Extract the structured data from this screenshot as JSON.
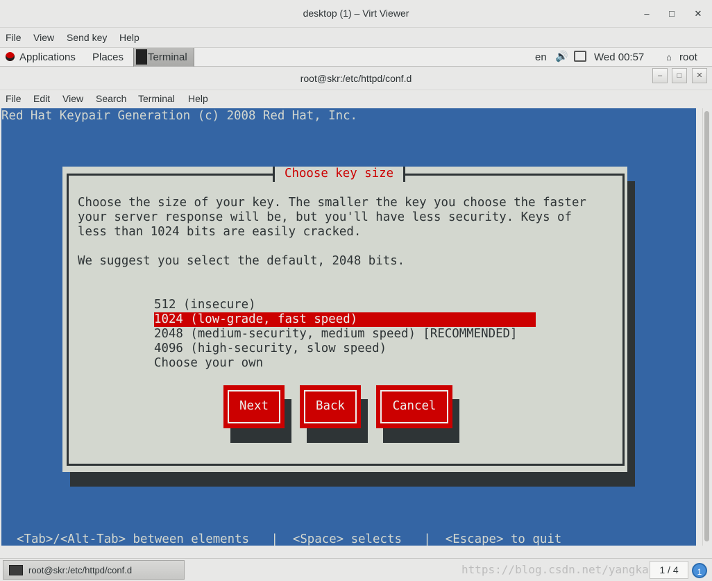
{
  "viewer": {
    "title": "desktop (1) – Virt Viewer",
    "controls": [
      "–",
      "□",
      "✕"
    ],
    "menu": [
      "File",
      "View",
      "Send key",
      "Help"
    ]
  },
  "panel": {
    "applications": "Applications",
    "places": "Places",
    "task": "Terminal",
    "lang": "en",
    "volume_icon": "volume-icon",
    "network_icon": "network-icon",
    "clock": "Wed 00:57",
    "user": "root"
  },
  "terminal": {
    "title": "root@skr:/etc/httpd/conf.d",
    "menu": [
      "File",
      "Edit",
      "View",
      "Search",
      "Terminal",
      "Help"
    ],
    "header": "Red Hat Keypair Generation (c) 2008 Red Hat, Inc.",
    "dialog": {
      "title": "Choose key size",
      "lines": [
        "Choose the size of your key. The smaller the key you choose the faster",
        "your server response will be, but you'll have less security. Keys of",
        "less than 1024 bits are easily cracked."
      ],
      "suggest": "We suggest you select the default, 2048 bits.",
      "options": [
        "512 (insecure)",
        "1024 (low-grade, fast speed)",
        "2048 (medium-security, medium speed) [RECOMMENDED]",
        "4096 (high-security, slow speed)",
        "Choose your own"
      ],
      "selected_index": 1,
      "buttons": {
        "next": "Next",
        "back": "Back",
        "cancel": "Cancel"
      }
    },
    "help": "<Tab>/<Alt-Tab> between elements   |  <Space> selects   |  <Escape> to quit"
  },
  "taskbar": {
    "item": "root@skr:/etc/httpd/conf.d",
    "watermark": "https://blog.csdn.net/yangka",
    "pager": "1 / 4",
    "notification": "1"
  },
  "colors": {
    "terminal_bg": "#3465a4",
    "dialog_bg": "#d3d7cf",
    "accent_red": "#cc0000",
    "shadow": "#2e3436"
  }
}
